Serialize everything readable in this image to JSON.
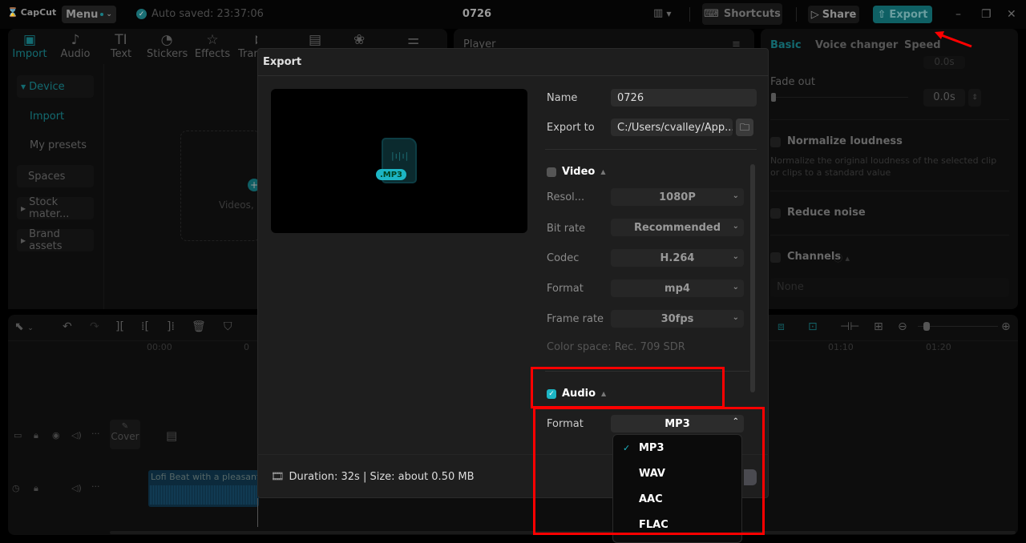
{
  "titlebar": {
    "app_name": "CapCut",
    "menu_label": "Menu",
    "autosave_text": "Auto saved: 23:37:06",
    "project_title": "0726",
    "shortcuts_label": "Shortcuts",
    "share_label": "Share",
    "export_label": "Export"
  },
  "toolbar": {
    "tools": [
      {
        "label": "Import",
        "icon": "import-icon",
        "glyph": "▶"
      },
      {
        "label": "Audio",
        "icon": "audio-icon",
        "glyph": "♫"
      },
      {
        "label": "Text",
        "icon": "text-icon",
        "glyph": "TI"
      },
      {
        "label": "Stickers",
        "icon": "stickers-icon",
        "glyph": "◔"
      },
      {
        "label": "Effects",
        "icon": "effects-icon",
        "glyph": "☆"
      },
      {
        "label": "Tran",
        "icon": "transitions-icon",
        "glyph": "⋈"
      }
    ]
  },
  "sidebar": {
    "items": [
      {
        "label": "Device",
        "expanded": true
      },
      {
        "label": "Import",
        "sub": true,
        "active": true
      },
      {
        "label": "My presets",
        "sub": true
      },
      {
        "label": "Spaces"
      },
      {
        "label": "Stock mater..."
      },
      {
        "label": "Brand assets"
      }
    ]
  },
  "media": {
    "dropzone_text": "Videos, a"
  },
  "player": {
    "title": "Player"
  },
  "right_panel": {
    "tabs": [
      "Basic",
      "Voice changer",
      "Speed"
    ],
    "fade_in_value": "0.0s",
    "fade_out_label": "Fade out",
    "fade_out_value": "0.0s",
    "normalize_label": "Normalize loudness",
    "normalize_desc": "Normalize the original loudness of the selected clip or clips to a standard value",
    "reduce_noise_label": "Reduce noise",
    "channels_label": "Channels",
    "channels_value": "None"
  },
  "timeline": {
    "ruler": [
      "00:00",
      "0",
      "01:10",
      "01:20"
    ],
    "cover_label": "Cover",
    "audio_clip_label": "Lofi Beat with a pleasant"
  },
  "export_dialog": {
    "title": "Export",
    "preview_badge": ".MP3",
    "name_label": "Name",
    "name_value": "0726",
    "export_to_label": "Export to",
    "export_to_value": "C:/Users/cvalley/App...",
    "video": {
      "label": "Video",
      "checked": false,
      "resolution_label": "Resol...",
      "resolution_value": "1080P",
      "bitrate_label": "Bit rate",
      "bitrate_value": "Recommended",
      "codec_label": "Codec",
      "codec_value": "H.264",
      "format_label": "Format",
      "format_value": "mp4",
      "framerate_label": "Frame rate",
      "framerate_value": "30fps",
      "colorspace_text": "Color space: Rec. 709 SDR"
    },
    "audio": {
      "label": "Audio",
      "checked": true,
      "format_label": "Format",
      "format_value": "MP3",
      "format_options": [
        "MP3",
        "WAV",
        "AAC",
        "FLAC"
      ],
      "selected_option": "MP3"
    },
    "footer_text": "Duration: 32s | Size: about 0.50 MB"
  },
  "colors": {
    "accent": "#1cb5c4",
    "annotation_red": "#ff0000",
    "dialog_bg": "#1e1e1e"
  }
}
